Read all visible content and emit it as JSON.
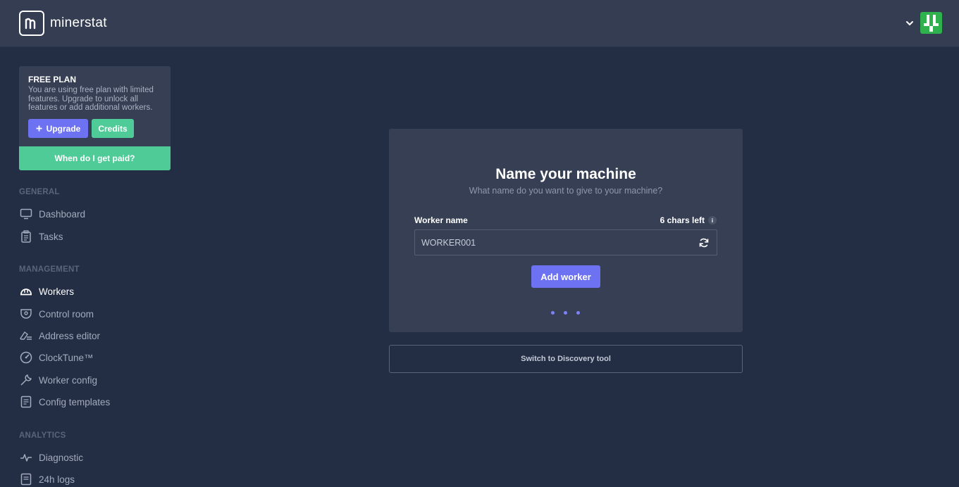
{
  "app": {
    "logo_text": "minerstat",
    "colors": {
      "background": "#232d44",
      "topbar": "#343d52",
      "card": "#363f54",
      "accent": "#6c72f2",
      "success": "#4fcb98",
      "avatar": "#2fb14d"
    }
  },
  "header": {
    "menu_icon": "chevron-down-icon",
    "avatar_icon": "user-avatar-icon"
  },
  "plan": {
    "title": "FREE PLAN",
    "description": "You are using free plan with limited features. Upgrade to unlock all features or add additional workers.",
    "upgrade_label": "Upgrade",
    "credits_label": "Credits",
    "paid_label": "When do I get paid?"
  },
  "sidebar": {
    "sections": [
      {
        "label": "GENERAL",
        "items": [
          {
            "label": "Dashboard",
            "icon": "monitor-icon"
          },
          {
            "label": "Tasks",
            "icon": "clipboard-icon"
          }
        ]
      },
      {
        "label": "MANAGEMENT",
        "items": [
          {
            "label": "Workers",
            "icon": "hardhat-icon",
            "active": true
          },
          {
            "label": "Control room",
            "icon": "camera-icon"
          },
          {
            "label": "Address editor",
            "icon": "eraser-icon"
          },
          {
            "label": "ClockTune™",
            "icon": "gauge-icon"
          },
          {
            "label": "Worker config",
            "icon": "wrench-icon"
          },
          {
            "label": "Config templates",
            "icon": "template-icon"
          }
        ]
      },
      {
        "label": "ANALYTICS",
        "items": [
          {
            "label": "Diagnostic",
            "icon": "pulse-icon"
          },
          {
            "label": "24h logs",
            "icon": "log-icon"
          }
        ]
      }
    ]
  },
  "main": {
    "title": "Name your machine",
    "subtitle": "What name do you want to give to your machine?",
    "field_label": "Worker name",
    "chars_left": "6 chars left",
    "info_glyph": "i",
    "input_value": "WORKER001",
    "add_button": "Add worker",
    "discovery_button": "Switch to Discovery tool"
  }
}
